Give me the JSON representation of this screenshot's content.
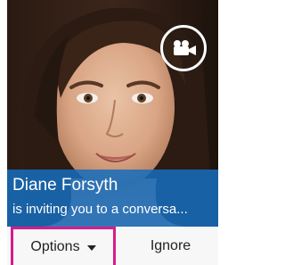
{
  "notification": {
    "caller_name": "Diane Forsyth",
    "invite_text": "is inviting you to a conversa..."
  },
  "actions": {
    "options_label": "Options",
    "ignore_label": "Ignore"
  },
  "icons": {
    "video": "video-camera-icon",
    "dropdown": "caret-down-icon"
  },
  "colors": {
    "caption_background": "#166EBE",
    "highlight_border": "#D81B8C"
  }
}
